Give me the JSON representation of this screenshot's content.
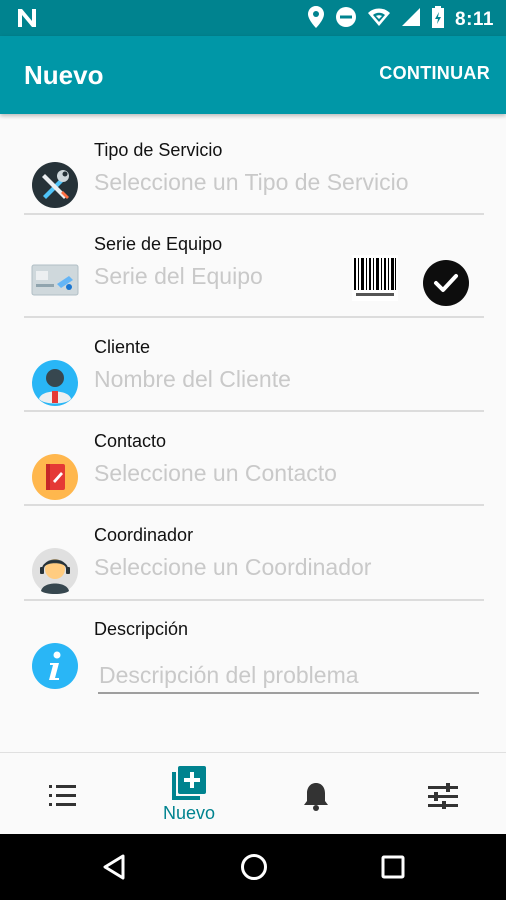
{
  "status_bar": {
    "time": "8:11"
  },
  "app_bar": {
    "title": "Nuevo",
    "action": "CONTINUAR"
  },
  "form": {
    "tipo_servicio": {
      "label": "Tipo de Servicio",
      "placeholder": "Seleccione un Tipo de Servicio"
    },
    "serie_equipo": {
      "label": "Serie de Equipo",
      "placeholder": "Serie del Equipo"
    },
    "cliente": {
      "label": "Cliente",
      "placeholder": "Nombre del Cliente"
    },
    "contacto": {
      "label": "Contacto",
      "placeholder": "Seleccione un Contacto"
    },
    "coordinador": {
      "label": "Coordinador",
      "placeholder": "Seleccione un Coordinador"
    },
    "descripcion": {
      "label": "Descripción",
      "placeholder": "Descripción del problema"
    }
  },
  "bottom_nav": {
    "items": [
      {
        "icon": "list-numbered-icon",
        "label": ""
      },
      {
        "icon": "add-box-icon",
        "label": "Nuevo",
        "active": true
      },
      {
        "icon": "bell-icon",
        "label": ""
      },
      {
        "icon": "sliders-icon",
        "label": ""
      }
    ]
  },
  "colors": {
    "status_bar": "#00838f",
    "app_bar": "#0097a7",
    "accent": "#00838f"
  }
}
